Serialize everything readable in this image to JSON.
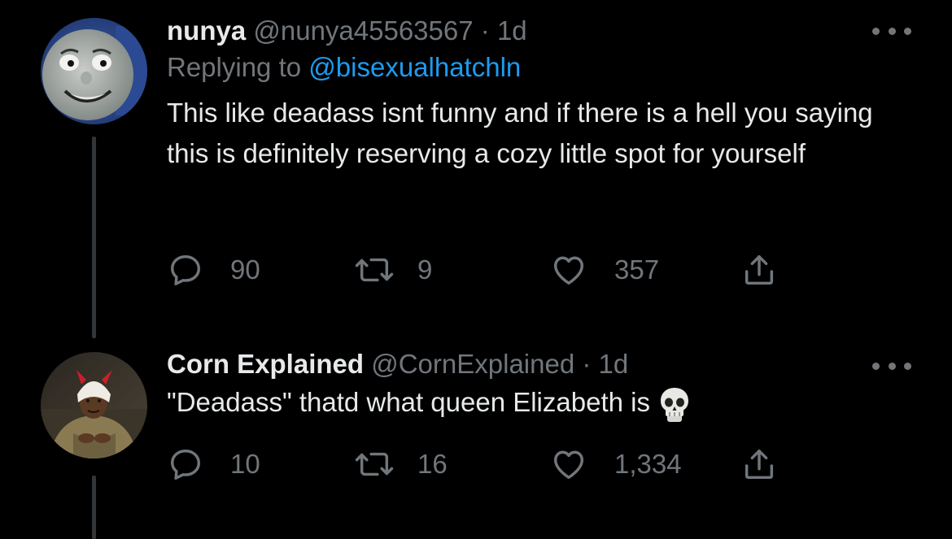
{
  "tweets": [
    {
      "display_name": "nunya",
      "handle": "@nunya45563567",
      "separator": "·",
      "time": "1d",
      "replying_to_prefix": "Replying to",
      "replying_to_handle": "@bisexualhatchln",
      "text": "This like deadass isnt funny and if there is a hell you saying this is definitely reserving a cozy little spot for yourself",
      "replies": "90",
      "retweets": "9",
      "likes": "357",
      "avatar": "train-face-avatar"
    },
    {
      "display_name": "Corn Explained",
      "handle": "@CornExplained",
      "separator": "·",
      "time": "1d",
      "text": "\"Deadass\" thatd what queen Elizabeth is",
      "emoji": "skull-emoji",
      "replies": "10",
      "retweets": "16",
      "likes": "1,334",
      "avatar": "person-with-devil-hat-avatar"
    }
  ],
  "colors": {
    "background": "#000000",
    "primary_text": "#e7e9ea",
    "secondary_text": "#71767b",
    "link": "#1d9bf0",
    "thread_line": "#333639"
  },
  "icons": [
    "more-icon",
    "reply-icon",
    "retweet-icon",
    "like-icon",
    "share-icon"
  ]
}
